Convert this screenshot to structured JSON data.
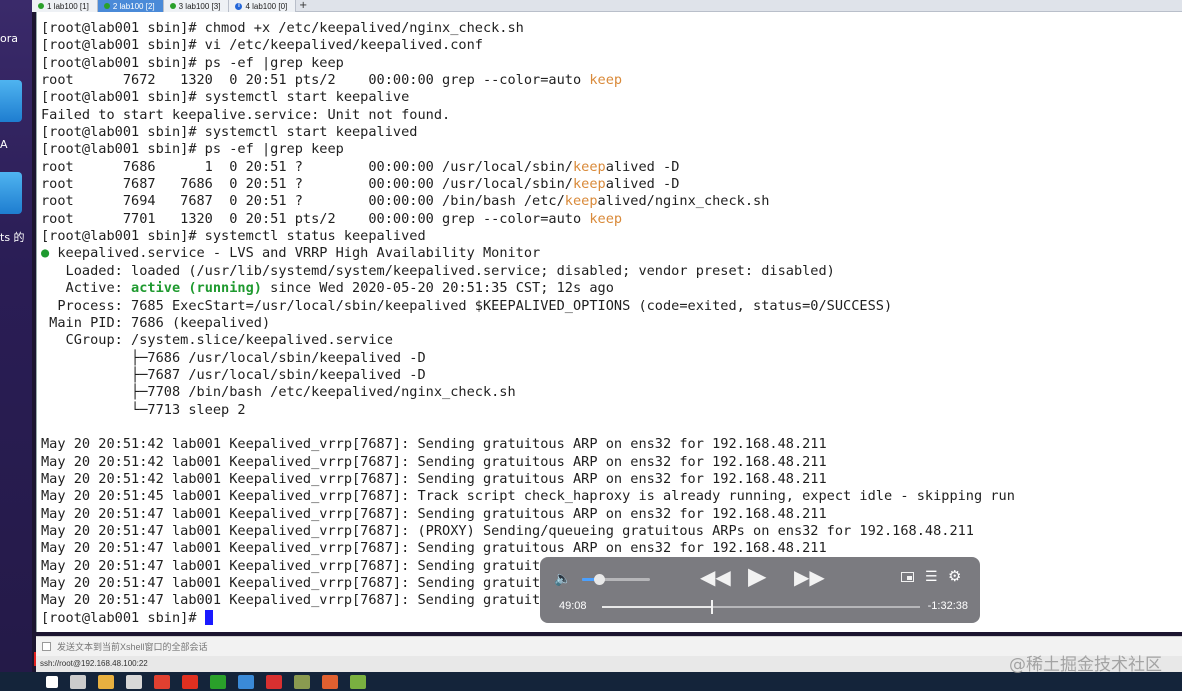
{
  "desktop": {
    "labels": [
      "ora",
      "A",
      "ts 的"
    ]
  },
  "tabs": [
    {
      "label": "1 lab100 [1]",
      "indicator": "green-dot",
      "active": false
    },
    {
      "label": "2 lab100 [2]",
      "indicator": "green-dot",
      "active": true
    },
    {
      "label": "3 lab100 [3]",
      "indicator": "green-dot",
      "active": false
    },
    {
      "label": "4 lab100 [0]",
      "indicator": "info-icon",
      "active": false
    }
  ],
  "tab_add_label": "+",
  "terminal": {
    "lines": [
      [
        {
          "t": "[root@lab001 sbin]# chmod +x /etc/keepalived/nginx_check.sh"
        }
      ],
      [
        {
          "t": "[root@lab001 sbin]# vi /etc/keepalived/keepalived.conf"
        }
      ],
      [
        {
          "t": "[root@lab001 sbin]# ps -ef |grep keep"
        }
      ],
      [
        {
          "t": "root      7672   1320  0 20:51 pts/2    00:00:00 grep --color=auto "
        },
        {
          "t": "keep",
          "c": "hl"
        }
      ],
      [
        {
          "t": "[root@lab001 sbin]# systemctl start keepalive"
        }
      ],
      [
        {
          "t": "Failed to start keepalive.service: Unit not found."
        }
      ],
      [
        {
          "t": "[root@lab001 sbin]# systemctl start keepalived"
        }
      ],
      [
        {
          "t": "[root@lab001 sbin]# ps -ef |grep keep"
        }
      ],
      [
        {
          "t": "root      7686      1  0 20:51 ?        00:00:00 /usr/local/sbin/"
        },
        {
          "t": "keep",
          "c": "hl"
        },
        {
          "t": "alived -D"
        }
      ],
      [
        {
          "t": "root      7687   7686  0 20:51 ?        00:00:00 /usr/local/sbin/"
        },
        {
          "t": "keep",
          "c": "hl"
        },
        {
          "t": "alived -D"
        }
      ],
      [
        {
          "t": "root      7694   7687  0 20:51 ?        00:00:00 /bin/bash /etc/"
        },
        {
          "t": "keep",
          "c": "hl"
        },
        {
          "t": "alived/nginx_check.sh"
        }
      ],
      [
        {
          "t": "root      7701   1320  0 20:51 pts/2    00:00:00 grep --color=auto "
        },
        {
          "t": "keep",
          "c": "hl"
        }
      ],
      [
        {
          "t": "[root@lab001 sbin]# systemctl status keepalived"
        }
      ],
      [
        {
          "t": "●",
          "c": "bullet"
        },
        {
          "t": " keepalived.service - LVS and VRRP High Availability Monitor"
        }
      ],
      [
        {
          "t": "   Loaded: loaded (/usr/lib/systemd/system/keepalived.service; disabled; vendor preset: disabled)"
        }
      ],
      [
        {
          "t": "   Active: "
        },
        {
          "t": "active (running)",
          "c": "ok"
        },
        {
          "t": " since Wed 2020-05-20 20:51:35 CST; 12s ago"
        }
      ],
      [
        {
          "t": "  Process: 7685 ExecStart=/usr/local/sbin/keepalived $KEEPALIVED_OPTIONS (code=exited, status=0/SUCCESS)"
        }
      ],
      [
        {
          "t": " Main PID: 7686 (keepalived)"
        }
      ],
      [
        {
          "t": "   CGroup: /system.slice/keepalived.service"
        }
      ],
      [
        {
          "t": "           ├─7686 /usr/local/sbin/keepalived -D"
        }
      ],
      [
        {
          "t": "           ├─7687 /usr/local/sbin/keepalived -D"
        }
      ],
      [
        {
          "t": "           ├─7708 /bin/bash /etc/keepalived/nginx_check.sh"
        }
      ],
      [
        {
          "t": "           └─7713 sleep 2"
        }
      ],
      [
        {
          "t": ""
        }
      ],
      [
        {
          "t": "May 20 20:51:42 lab001 Keepalived_vrrp[7687]: Sending gratuitous ARP on ens32 for 192.168.48.211"
        }
      ],
      [
        {
          "t": "May 20 20:51:42 lab001 Keepalived_vrrp[7687]: Sending gratuitous ARP on ens32 for 192.168.48.211"
        }
      ],
      [
        {
          "t": "May 20 20:51:42 lab001 Keepalived_vrrp[7687]: Sending gratuitous ARP on ens32 for 192.168.48.211"
        }
      ],
      [
        {
          "t": "May 20 20:51:45 lab001 Keepalived_vrrp[7687]: Track script check_haproxy is already running, expect idle - skipping run"
        }
      ],
      [
        {
          "t": "May 20 20:51:47 lab001 Keepalived_vrrp[7687]: Sending gratuitous ARP on ens32 for 192.168.48.211"
        }
      ],
      [
        {
          "t": "May 20 20:51:47 lab001 Keepalived_vrrp[7687]: (PROXY) Sending/queueing gratuitous ARPs on ens32 for 192.168.48.211"
        }
      ],
      [
        {
          "t": "May 20 20:51:47 lab001 Keepalived_vrrp[7687]: Sending gratuitous ARP on ens32 for 192.168.48.211"
        }
      ],
      [
        {
          "t": "May 20 20:51:47 lab001 Keepalived_vrrp[7687]: Sending gratuit"
        }
      ],
      [
        {
          "t": "May 20 20:51:47 lab001 Keepalived_vrrp[7687]: Sending gratuit"
        }
      ],
      [
        {
          "t": "May 20 20:51:47 lab001 Keepalived_vrrp[7687]: Sending gratuit"
        }
      ],
      [
        {
          "t": "[root@lab001 sbin]# "
        },
        {
          "cursor": true
        }
      ]
    ]
  },
  "sendbar": {
    "text": "发送文本到当前Xshell窗口的全部会话"
  },
  "pathbar": {
    "text": "ssh://root@192.168.48.100:22"
  },
  "watermark": "@稀土掘金技术社区",
  "player": {
    "elapsed": "49:08",
    "remaining": "-1:32:38",
    "progress_fraction": 0.347,
    "volume_fraction": 0.25,
    "icons": {
      "volume": "🔈",
      "rewind": "◀◀",
      "play": "▶",
      "forward": "▶▶",
      "playlist": "☰",
      "settings": "⚙"
    }
  },
  "taskbar_icons": [
    "windows-start-icon",
    "search-icon",
    "file-explorer-icon",
    "text-editor-icon",
    "chrome-icon",
    "app-red-icon",
    "wechat-icon",
    "app-blue-icon",
    "app-red-x-icon",
    "app-window-icon",
    "app-orange-icon",
    "app-green-icon"
  ],
  "colors": {
    "highlight": "#d98a3a",
    "active_green": "#1f9a2f",
    "cursor": "#1a1aff",
    "active_tab": "#4a8ad8"
  }
}
